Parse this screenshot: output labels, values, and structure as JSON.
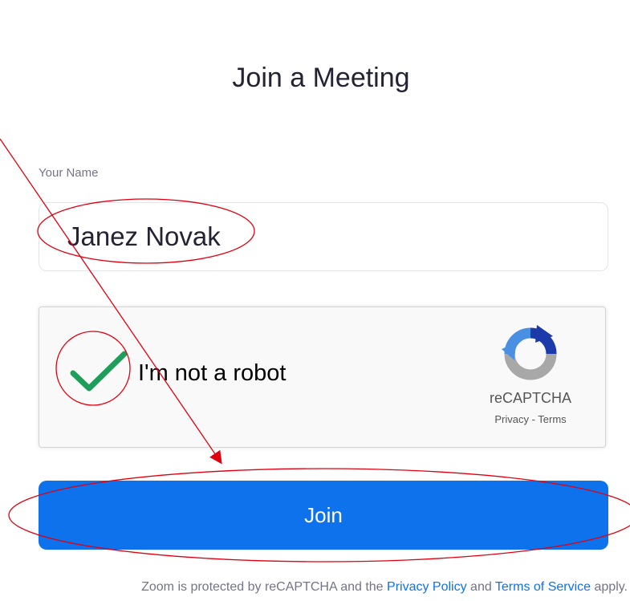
{
  "page": {
    "title": "Join a Meeting"
  },
  "form": {
    "name_label": "Your Name",
    "name_value": "Janez Novak",
    "join_label": "Join"
  },
  "captcha": {
    "label": "I'm not a robot",
    "checked": true,
    "brand": "reCAPTCHA",
    "privacy_link": "Privacy",
    "separator": " - ",
    "terms_link": "Terms",
    "icon": "recaptcha-logo-icon"
  },
  "footer": {
    "prefix": "Zoom is protected by reCAPTCHA and the ",
    "privacy_policy": "Privacy Policy",
    "middle": " and ",
    "terms_of_service": "Terms of Service",
    "suffix": " apply."
  },
  "colors": {
    "accent": "#0e72ed",
    "checkmark": "#1e9e5a",
    "annotation": "#e0000f"
  }
}
